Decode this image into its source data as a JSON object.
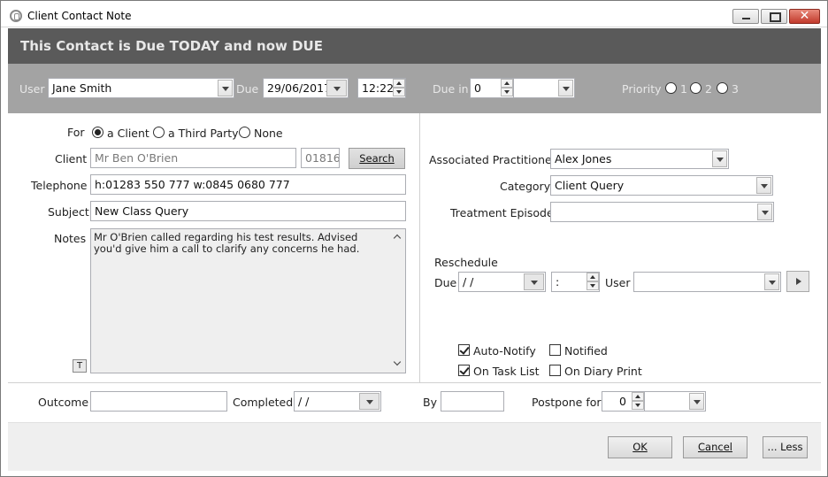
{
  "window": {
    "title": "Client Contact Note"
  },
  "banner": {
    "text": "This Contact is Due TODAY and now DUE"
  },
  "toolbar": {
    "user_label": "User",
    "user_value": "Jane Smith",
    "due_label": "Due",
    "due_date": "29/06/2017",
    "due_time": "12:22",
    "due_in_label": "Due in",
    "due_in_value": "0",
    "priority_label": "Priority",
    "priority_options": [
      "1",
      "2",
      "3"
    ]
  },
  "for_row": {
    "label": "For",
    "options": [
      "a Client",
      "a Third Party",
      "None"
    ],
    "selected": "a Client"
  },
  "client": {
    "label": "Client",
    "value": "Mr Ben O'Brien",
    "code": "01816",
    "search_label": "Search"
  },
  "telephone": {
    "label": "Telephone",
    "value": "h:01283 550 777  w:0845 0680 777"
  },
  "subject": {
    "label": "Subject",
    "value": "New Class Query"
  },
  "notes": {
    "label": "Notes",
    "value": "Mr O'Brien called regarding his test results. Advised you'd give him a call to clarify any concerns he had.",
    "t_button": "T"
  },
  "right_panel": {
    "associated_label": "Associated Practitioner",
    "associated_value": "Alex Jones",
    "category_label": "Category",
    "category_value": "Client Query",
    "treatment_label": "Treatment Episode",
    "treatment_value": "",
    "reschedule_label": "Reschedule",
    "due_label": "Due",
    "due_value": " /  /",
    "time_value": " :",
    "user_label": "User",
    "user_value": ""
  },
  "checkboxes": {
    "auto_notify": "Auto-Notify",
    "notified": "Notified",
    "on_task_list": "On Task List",
    "on_diary_print": "On Diary Print"
  },
  "bottom": {
    "outcome_label": "Outcome",
    "outcome_value": "",
    "completed_label": "Completed",
    "completed_value": " /  /",
    "by_label": "By",
    "by_value": "",
    "postpone_label": "Postpone for",
    "postpone_value": "0"
  },
  "buttons": {
    "ok": "OK",
    "cancel": "Cancel",
    "less": "... Less"
  }
}
